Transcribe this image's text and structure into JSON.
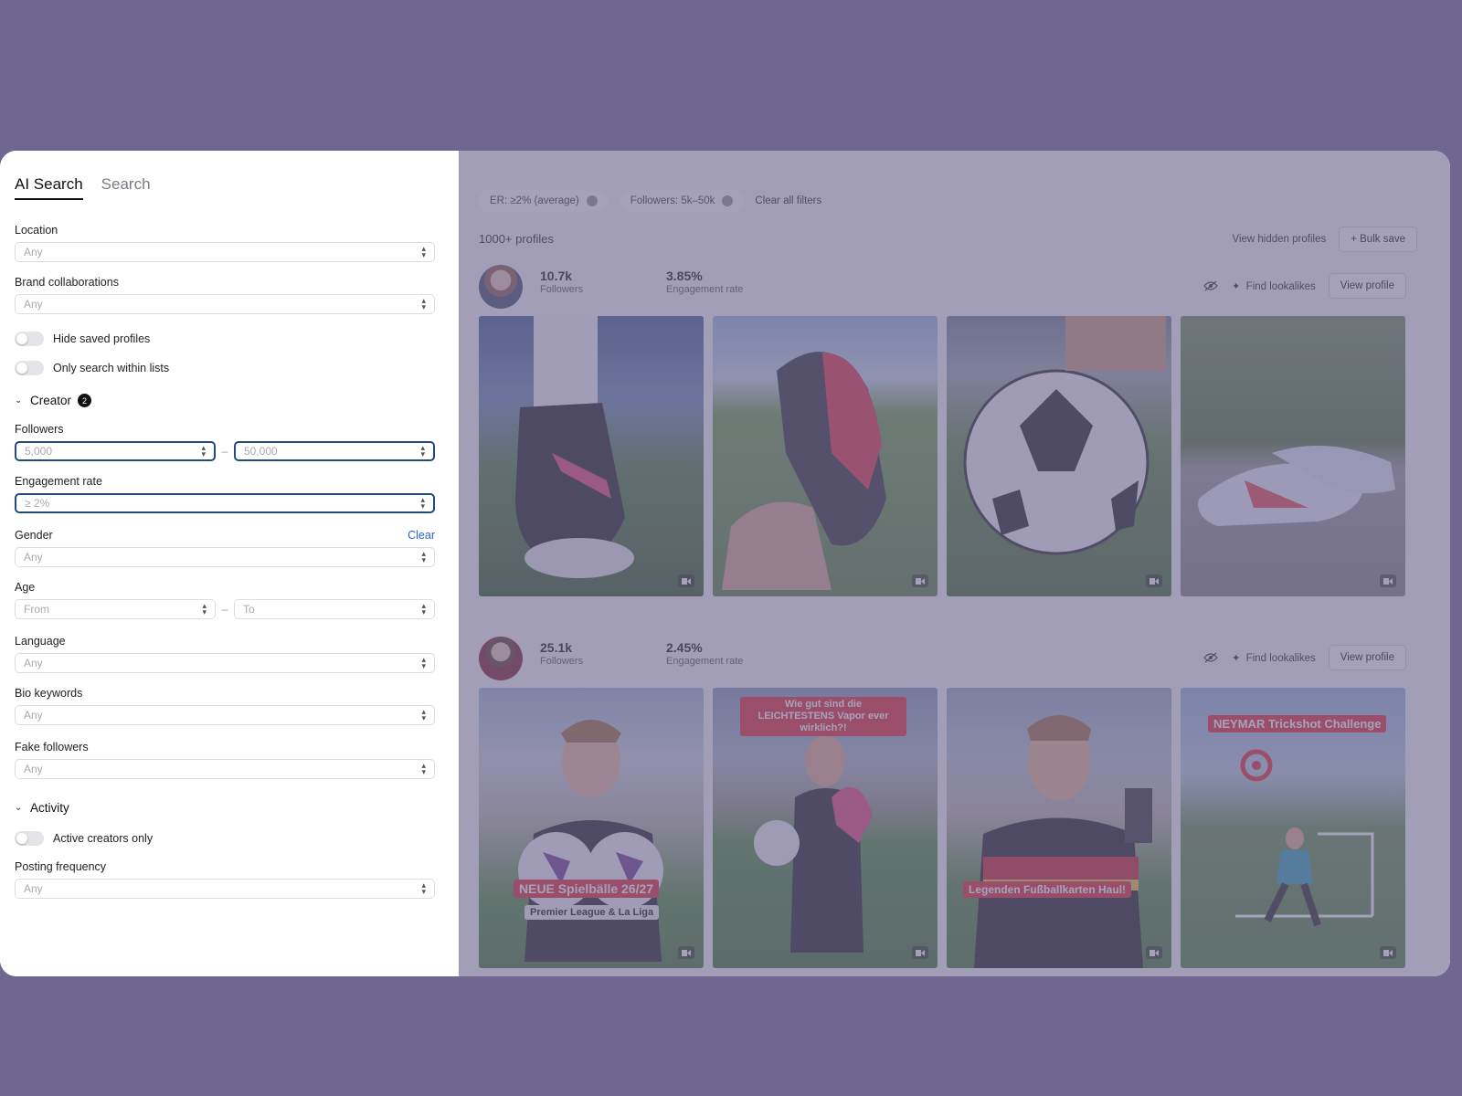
{
  "sidebar": {
    "tabs": [
      {
        "label": "AI Search"
      },
      {
        "label": "Search"
      }
    ],
    "location": {
      "label": "Location",
      "value": "Any"
    },
    "brand": {
      "label": "Brand collaborations",
      "value": "Any"
    },
    "hide_saved": {
      "label": "Hide saved profiles"
    },
    "only_lists": {
      "label": "Only search within lists"
    },
    "creator": {
      "label": "Creator",
      "badge": "2"
    },
    "followers": {
      "label": "Followers",
      "from": "5,000",
      "to": "50,000"
    },
    "engagement": {
      "label": "Engagement rate",
      "value": "≥ 2%"
    },
    "gender": {
      "label": "Gender",
      "clear": "Clear",
      "value": "Any"
    },
    "age": {
      "label": "Age",
      "from": "From",
      "to": "To"
    },
    "language": {
      "label": "Language",
      "value": "Any"
    },
    "bio": {
      "label": "Bio keywords",
      "value": "Any"
    },
    "fake": {
      "label": "Fake followers",
      "value": "Any"
    },
    "activity": {
      "label": "Activity"
    },
    "active_only": {
      "label": "Active creators only"
    },
    "posting": {
      "label": "Posting frequency",
      "value": "Any"
    }
  },
  "filters": {
    "chips": [
      {
        "label": "ER: ≥2% (average)"
      },
      {
        "label": "Followers: 5k–50k"
      }
    ],
    "clear_all": "Clear all filters"
  },
  "results": {
    "count": "1000+ profiles",
    "view_hidden": "View hidden profiles",
    "bulk_save": "+ Bulk save"
  },
  "profiles": [
    {
      "followers": "10.7k",
      "followers_label": "Followers",
      "er": "3.85%",
      "er_label": "Engagement rate",
      "find": "Find lookalikes",
      "view": "View profile",
      "posts": [
        {
          "caption": ""
        },
        {
          "caption": ""
        },
        {
          "caption": ""
        },
        {
          "caption": ""
        }
      ]
    },
    {
      "followers": "25.1k",
      "followers_label": "Followers",
      "er": "2.45%",
      "er_label": "Engagement rate",
      "find": "Find lookalikes",
      "view": "View profile",
      "posts": [
        {
          "caption": "NEUE Spielbälle 26/27",
          "sub": "Premier League & La Liga"
        },
        {
          "caption": "Wie gut sind die LEICHTESTENS Vapor ever wirklich?!"
        },
        {
          "caption": "Legenden Fußballkarten Haul!"
        },
        {
          "caption": "NEYMAR Trickshot Challenge"
        }
      ]
    }
  ],
  "colors": {
    "accent": "#23497d",
    "link": "#2b62c8",
    "backdrop": "#6f678f"
  }
}
